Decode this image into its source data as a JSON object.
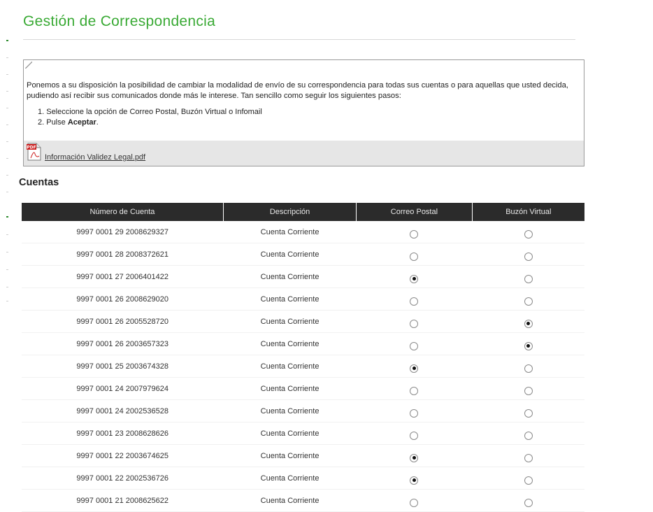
{
  "page": {
    "title": "Gestión de Correspondencia"
  },
  "info": {
    "paragraph": "Ponemos a su disposición la posibilidad de cambiar la modalidad de envío de su correspondencia para todas sus cuentas o para aquellas que usted decida, pudiendo así recibir sus comunicados donde más le interese. Tan sencillo como seguir los siguientes pasos:",
    "step1": "1. Seleccione la opción de Correo Postal, Buzón Virtual o Infomail",
    "step2_prefix": "2. Pulse ",
    "step2_bold": "Aceptar",
    "step2_suffix": ".",
    "pdf_icon_label": "PDF",
    "pdf_link": "Información Validez Legal.pdf"
  },
  "accounts": {
    "section_title": "Cuentas",
    "headers": {
      "number": "Número de Cuenta",
      "description": "Descripción",
      "postal": "Correo Postal",
      "virtual": "Buzón Virtual"
    },
    "rows": [
      {
        "number": "9997 0001 29 2008629327",
        "description": "Cuenta Corriente",
        "selected": "none"
      },
      {
        "number": "9997 0001 28 2008372621",
        "description": "Cuenta Corriente",
        "selected": "none"
      },
      {
        "number": "9997 0001 27 2006401422",
        "description": "Cuenta Corriente",
        "selected": "postal"
      },
      {
        "number": "9997 0001 26 2008629020",
        "description": "Cuenta Corriente",
        "selected": "none"
      },
      {
        "number": "9997 0001 26 2005528720",
        "description": "Cuenta Corriente",
        "selected": "virtual"
      },
      {
        "number": "9997 0001 26 2003657323",
        "description": "Cuenta Corriente",
        "selected": "virtual"
      },
      {
        "number": "9997 0001 25 2003674328",
        "description": "Cuenta Corriente",
        "selected": "postal"
      },
      {
        "number": "9997 0001 24 2007979624",
        "description": "Cuenta Corriente",
        "selected": "none"
      },
      {
        "number": "9997 0001 24 2002536528",
        "description": "Cuenta Corriente",
        "selected": "none"
      },
      {
        "number": "9997 0001 23 2008628626",
        "description": "Cuenta Corriente",
        "selected": "none"
      },
      {
        "number": "9997 0001 22 2003674625",
        "description": "Cuenta Corriente",
        "selected": "postal"
      },
      {
        "number": "9997 0001 22 2002536726",
        "description": "Cuenta Corriente",
        "selected": "postal"
      },
      {
        "number": "9997 0001 21 2008625622",
        "description": "Cuenta Corriente",
        "selected": "none"
      }
    ]
  },
  "colors": {
    "title_green": "#3aaa35",
    "table_header_bg": "#2b2b2b",
    "pdf_bar_bg": "#e6e6e6"
  }
}
